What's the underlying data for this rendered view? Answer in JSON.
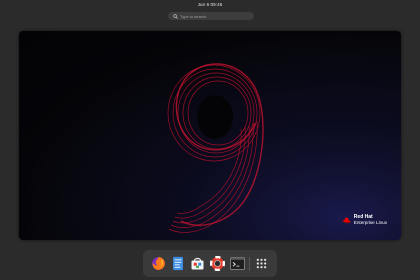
{
  "topbar": {
    "clock": "Jun 6  09:46"
  },
  "search": {
    "placeholder": "Type to search"
  },
  "wallpaper": {
    "brand_line1": "Red Hat",
    "brand_line2": "Enterprise Linux",
    "numeral": "9"
  },
  "dock": {
    "items": [
      {
        "icon": "firefox-icon"
      },
      {
        "icon": "text-editor-icon"
      },
      {
        "icon": "software-icon"
      },
      {
        "icon": "help-icon"
      },
      {
        "icon": "terminal-icon"
      },
      {
        "icon": "app-grid-icon"
      }
    ]
  },
  "colors": {
    "panel": "#2b2b2b",
    "dock": "#3a3a3a",
    "brand_red": "#ee0000",
    "numeral_red": "#b0112b"
  }
}
